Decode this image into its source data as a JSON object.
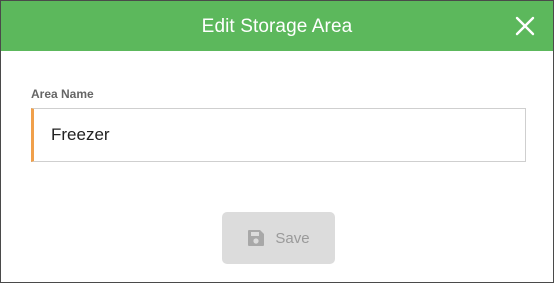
{
  "dialog": {
    "title": "Edit Storage Area",
    "close_icon": "close-icon",
    "header_color": "#5cb85c"
  },
  "form": {
    "area_name_label": "Area Name",
    "area_name_value": "Freezer",
    "accent_color": "#f0a04b"
  },
  "actions": {
    "save_label": "Save",
    "save_icon": "floppy-disk-icon",
    "save_disabled": true
  }
}
